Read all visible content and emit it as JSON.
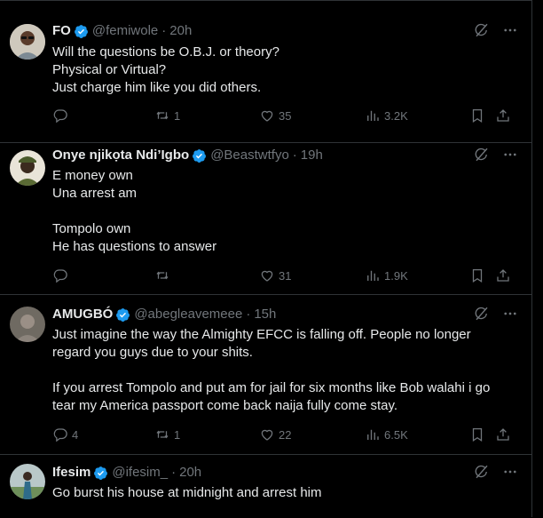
{
  "tweets": [
    {
      "name": "FO",
      "handle": "@femiwole",
      "time": "20h",
      "lines": [
        "Will the questions be O.B.J. or theory?",
        "Physical or Virtual?",
        "Just charge him like you did others."
      ],
      "replies": "",
      "reposts": "1",
      "likes": "35",
      "views": "3.2K",
      "avatar_icon": "man-with-glasses-avatar"
    },
    {
      "name": "Onye njikọta Ndi’Igbo",
      "handle": "@Beastwtfyo",
      "time": "19h",
      "lines": [
        "E money own",
        "Una arrest am",
        "",
        "Tompolo own",
        "He has questions to answer"
      ],
      "replies": "",
      "reposts": "",
      "likes": "31",
      "views": "1.9K",
      "avatar_icon": "man-in-cap-avatar"
    },
    {
      "name": "AMUGBÓ",
      "handle": "@abegleavemeee",
      "time": "15h",
      "lines": [
        "Just imagine the way the Almighty EFCC is falling off. People no longer",
        "regard you guys due to your shits.",
        "",
        "If you arrest Tompolo and put am for jail for six months like Bob walahi i go",
        "tear my America passport come back naija fully come stay."
      ],
      "replies": "4",
      "reposts": "1",
      "likes": "22",
      "views": "6.5K",
      "avatar_icon": "man-avatar"
    },
    {
      "name": "Ifesim",
      "handle": "@ifesim_",
      "time": "20h",
      "lines": [
        "Go burst his house at midnight and arrest him"
      ],
      "replies": "",
      "reposts": "",
      "likes": "",
      "views": "",
      "avatar_icon": "man-outdoors-avatar"
    }
  ],
  "icons": {
    "verified": "verified-badge-icon",
    "grok": "grok-icon",
    "more": "more-icon",
    "reply": "reply-icon",
    "repost": "repost-icon",
    "like": "like-icon",
    "views": "views-icon",
    "bookmark": "bookmark-icon",
    "share": "share-icon"
  },
  "colors": {
    "background": "#000000",
    "text": "#e7e9ea",
    "muted": "#71767b",
    "border": "#2f3336",
    "verified": "#1d9bf0"
  }
}
